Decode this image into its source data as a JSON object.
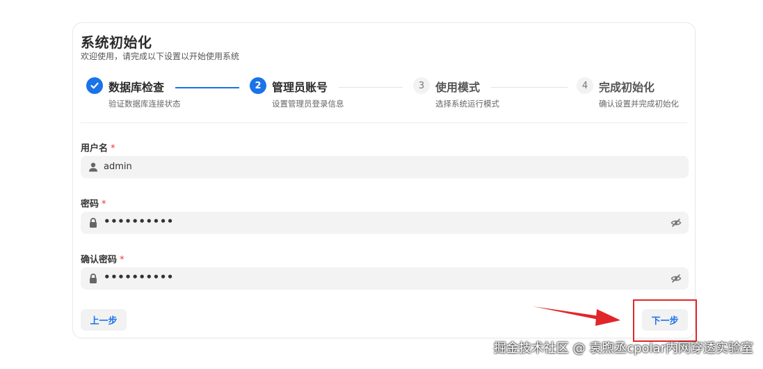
{
  "card": {
    "title": "系统初始化",
    "subtitle": "欢迎使用，请完成以下设置以开始使用系统"
  },
  "steps": [
    {
      "number": "",
      "title": "数据库检查",
      "description": "验证数据库连接状态",
      "status": "done"
    },
    {
      "number": "2",
      "title": "管理员账号",
      "description": "设置管理员登录信息",
      "status": "active"
    },
    {
      "number": "3",
      "title": "使用模式",
      "description": "选择系统运行模式",
      "status": "pending"
    },
    {
      "number": "4",
      "title": "完成初始化",
      "description": "确认设置并完成初始化",
      "status": "pending"
    }
  ],
  "form": {
    "username": {
      "label": "用户名",
      "required": "*",
      "value": "admin",
      "icon": "user-icon"
    },
    "password": {
      "label": "密码",
      "required": "*",
      "value": "••••••••••",
      "icon": "lock-icon"
    },
    "confirm_password": {
      "label": "确认密码",
      "required": "*",
      "value": "••••••••••",
      "icon": "lock-icon"
    }
  },
  "buttons": {
    "prev": "上一步",
    "next": "下一步"
  },
  "colors": {
    "accent": "#1a73e8",
    "highlight": "#e0262a",
    "required": "#e53935"
  },
  "watermark": "掘金技术社区 @ 袁煦丞cpolar内网穿透实验室"
}
